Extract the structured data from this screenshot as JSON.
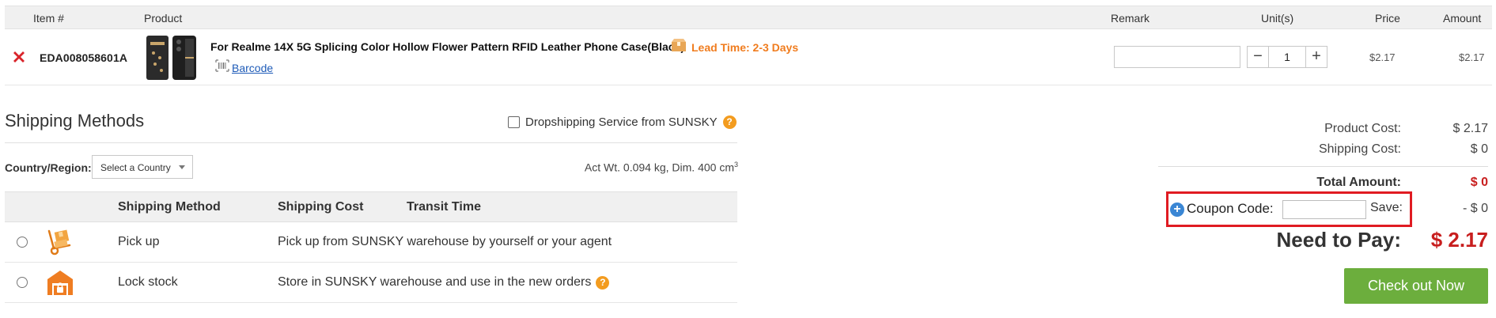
{
  "cart": {
    "headers": {
      "item_no": "Item #",
      "product": "Product",
      "remark": "Remark",
      "units": "Unit(s)",
      "price": "Price",
      "amount": "Amount"
    },
    "item": {
      "item_no": "EDA008058601A",
      "product_name": "For Realme 14X 5G Splicing Color Hollow Flower Pattern RFID Leather Phone Case(Black)",
      "lead_time": "Lead Time: 2-3 Days",
      "barcode_label": "Barcode",
      "remark_value": "",
      "quantity": "1",
      "price": "$2.17",
      "amount": "$2.17"
    }
  },
  "shipping": {
    "title": "Shipping Methods",
    "dropship_label": "Dropshipping Service from SUNSKY",
    "country_label": "Country/Region:",
    "country_select": "Select a Country",
    "weight_text": "Act Wt. 0.094 kg, Dim. 400 cm",
    "weight_sup": "3",
    "columns": {
      "method": "Shipping Method",
      "cost": "Shipping Cost",
      "transit": "Transit Time"
    },
    "methods": [
      {
        "name": "Pick up",
        "description": "Pick up from SUNSKY warehouse by yourself or your agent"
      },
      {
        "name": "Lock stock",
        "description": "Store in SUNSKY warehouse and use in the new orders"
      }
    ]
  },
  "summary": {
    "product_cost_label": "Product Cost:",
    "product_cost": "$ 2.17",
    "shipping_cost_label": "Shipping Cost:",
    "shipping_cost": "$ 0",
    "total_label": "Total Amount:",
    "total": "$ 0",
    "coupon_label": "Coupon Code:",
    "coupon_value": "",
    "save_label": "Save:",
    "save_value": "- $ 0",
    "need_label": "Need to Pay:",
    "need_value": "$ 2.17",
    "checkout_label": "Check out Now"
  },
  "colors": {
    "accent_orange": "#f07c1e",
    "price_red": "#c81e1e",
    "checkout_green": "#6cae3d",
    "highlight_red": "#e01b22",
    "link_blue": "#1e5bb8"
  }
}
